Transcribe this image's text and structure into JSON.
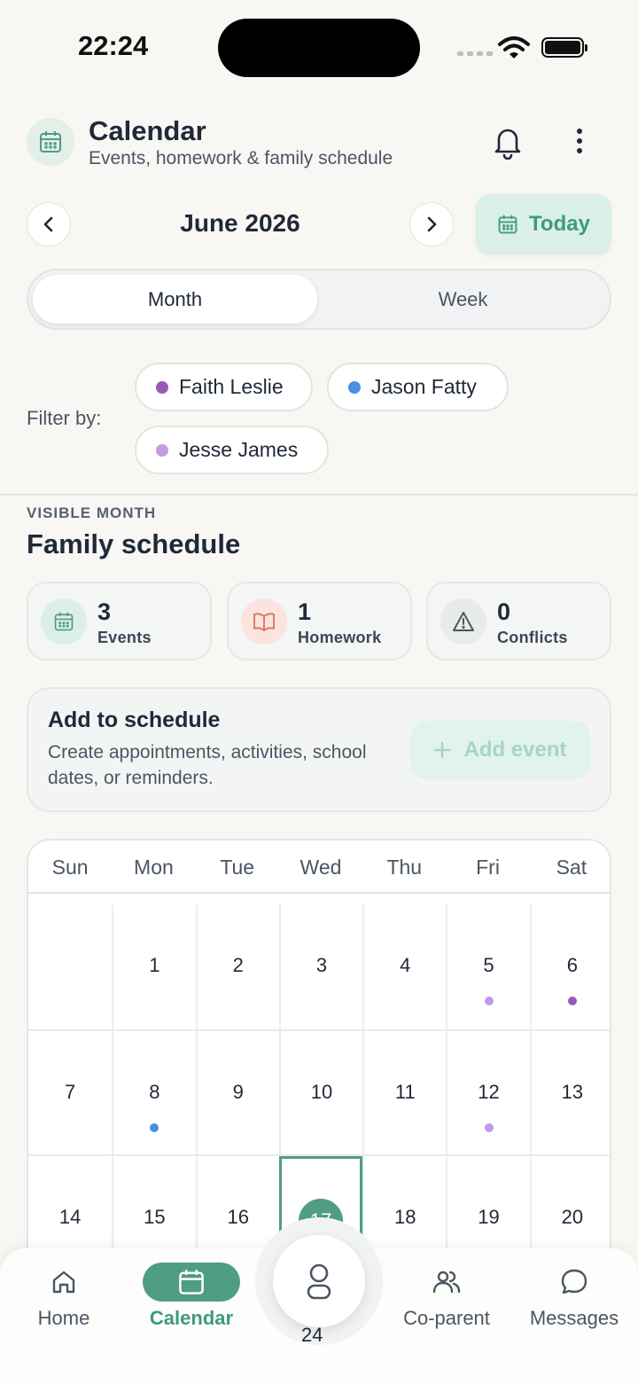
{
  "status_bar": {
    "time": "22:24"
  },
  "header": {
    "title": "Calendar",
    "subtitle": "Events, homework & family schedule"
  },
  "month_nav": {
    "label": "June 2026",
    "today_label": "Today"
  },
  "view_toggle": {
    "month": "Month",
    "week": "Week",
    "selected": "Month"
  },
  "filters": {
    "label": "Filter by:",
    "people": [
      {
        "name": "Faith Leslie",
        "color": "#9b59b6"
      },
      {
        "name": "Jason Fatty",
        "color": "#4a8fe2"
      },
      {
        "name": "Jesse James",
        "color": "#c39be3"
      }
    ]
  },
  "section": {
    "overline": "VISIBLE MONTH",
    "title": "Family schedule"
  },
  "stats": [
    {
      "value": "3",
      "label": "Events",
      "icon": "calendar-icon",
      "bg": "#dcefe7"
    },
    {
      "value": "1",
      "label": "Homework",
      "icon": "book-icon",
      "bg": "#fbe3df"
    },
    {
      "value": "0",
      "label": "Conflicts",
      "icon": "warning-icon",
      "bg": "#e9eaea"
    }
  ],
  "add_card": {
    "title": "Add to schedule",
    "description": "Create appointments, activities, school dates, or reminders.",
    "button_label": "Add event"
  },
  "calendar": {
    "weekdays": [
      "Sun",
      "Mon",
      "Tue",
      "Wed",
      "Thu",
      "Fri",
      "Sat"
    ],
    "weeks": [
      [
        "",
        "1",
        "2",
        "3",
        "4",
        "5",
        "6"
      ],
      [
        "7",
        "8",
        "9",
        "10",
        "11",
        "12",
        "13"
      ],
      [
        "14",
        "15",
        "16",
        "17",
        "18",
        "19",
        "20"
      ]
    ],
    "selected_day": "17",
    "peek_day": "24"
  },
  "colors": {
    "accent": "#4f9d82",
    "faith": "#9b59b6",
    "jason": "#4a8fe2",
    "jesse": "#c39be3"
  },
  "bottom_nav": {
    "home": "Home",
    "calendar": "Calendar",
    "coparent": "Co-parent",
    "messages": "Messages"
  }
}
